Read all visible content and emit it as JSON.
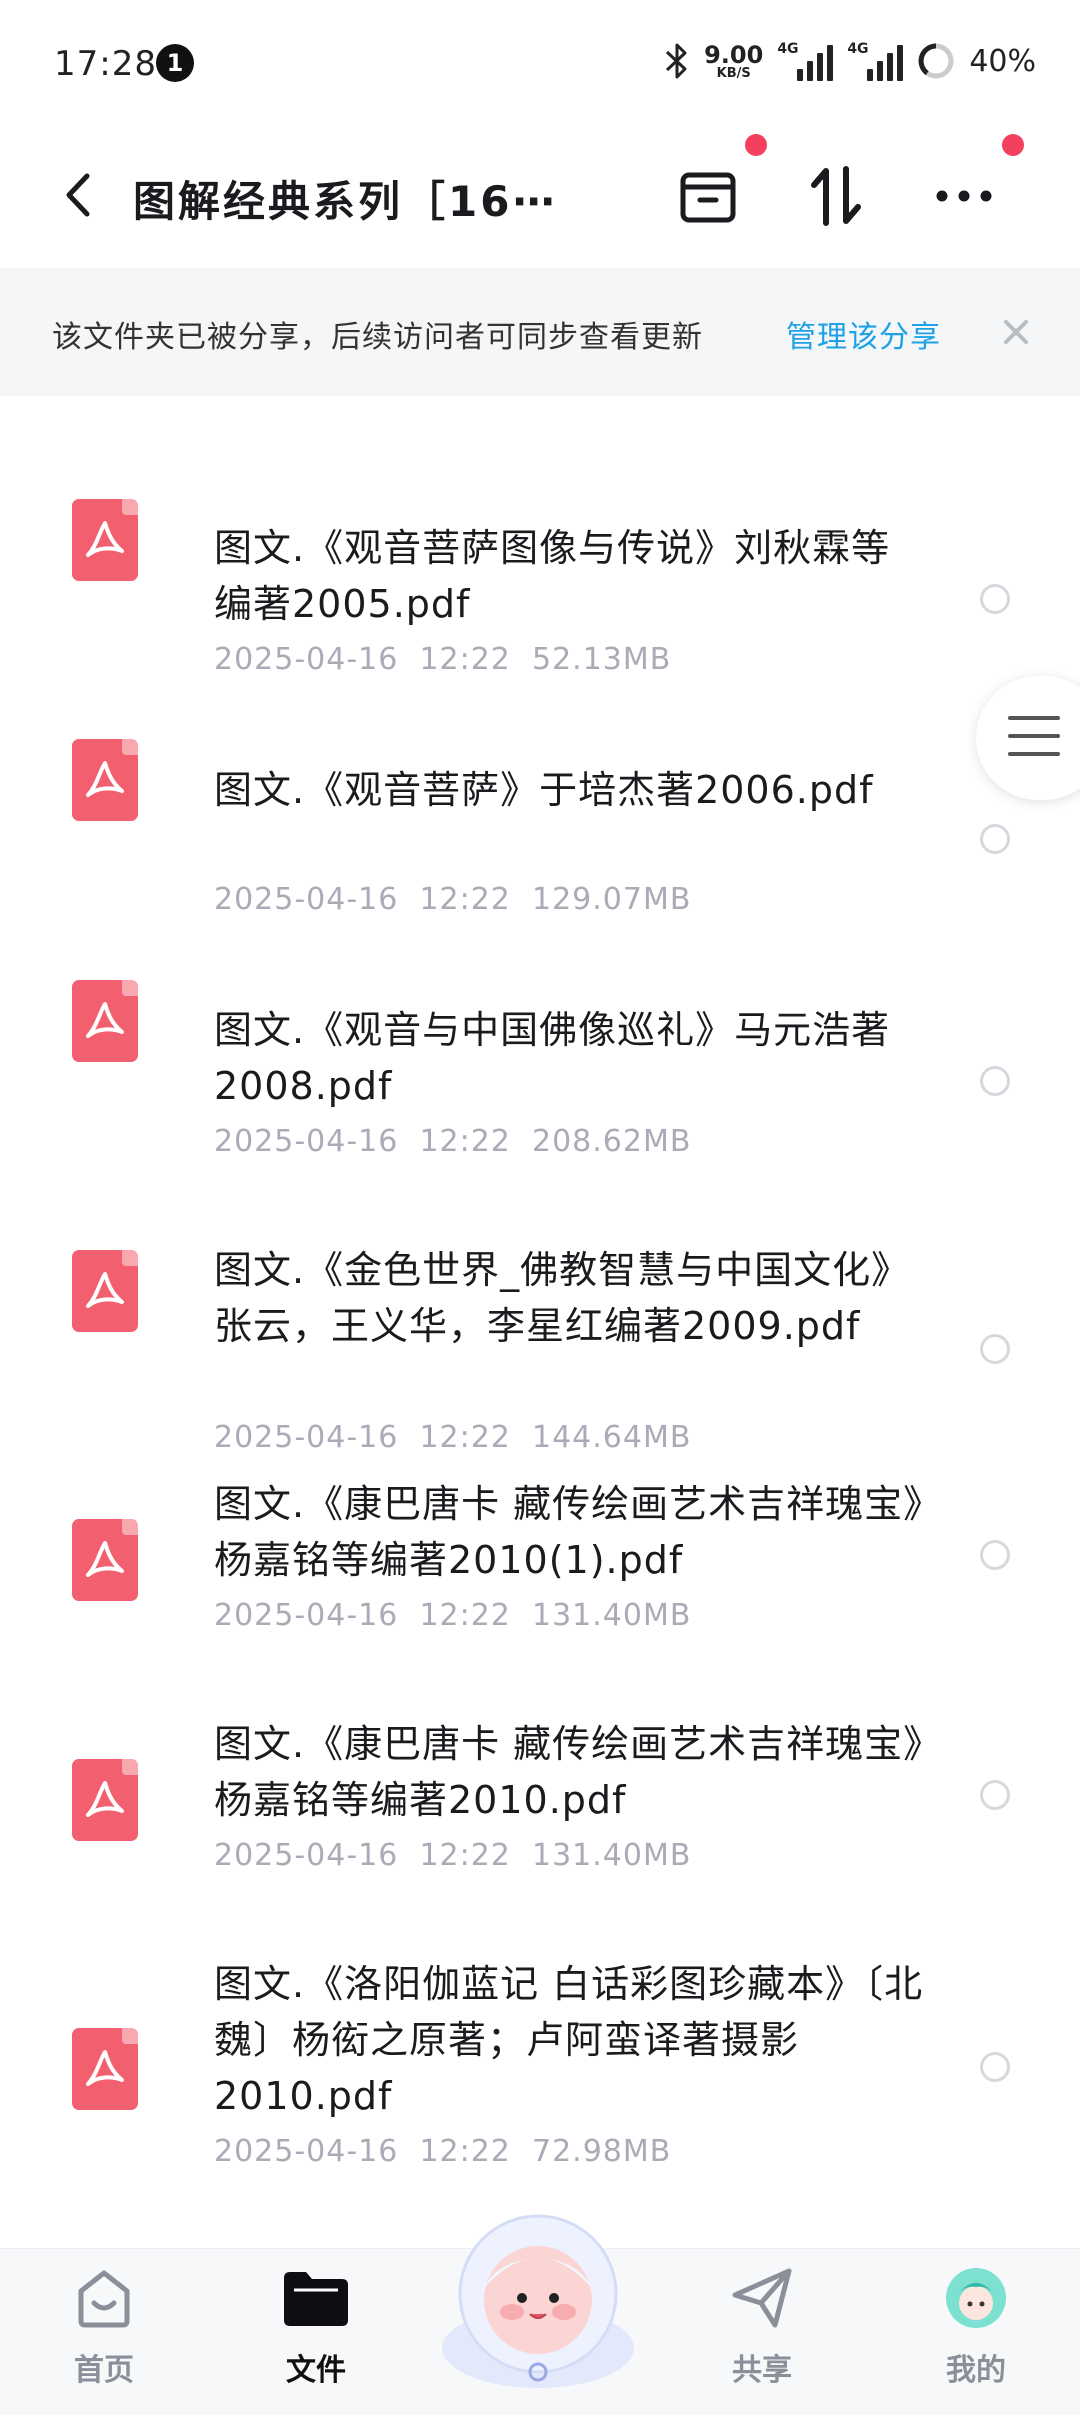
{
  "status_bar": {
    "time": "17:28",
    "notification_count": "1",
    "net_speed_value": "9.00",
    "net_speed_unit": "KB/S",
    "sim1_tag": "4G",
    "sim2_tag": "4G",
    "battery": "40%"
  },
  "header": {
    "title": "图解经典系列［16⋯",
    "icons": [
      "back-icon",
      "archive-icon",
      "sort-icon",
      "more-icon"
    ]
  },
  "share_banner": {
    "text": "该文件夹已被分享，后续访问者可同步查看更新",
    "link": "管理该分享"
  },
  "files": [
    {
      "name": "图文.《观音菩萨图像与传说》刘秋霖等编著2005.pdf",
      "date": "2025-04-16",
      "time": "12:22",
      "size": "52.13MB"
    },
    {
      "name": "图文.《观音菩萨》于培杰著2006.pdf",
      "date": "2025-04-16",
      "time": "12:22",
      "size": "129.07MB"
    },
    {
      "name": "图文.《观音与中国佛像巡礼》马元浩著2008.pdf",
      "date": "2025-04-16",
      "time": "12:22",
      "size": "208.62MB"
    },
    {
      "name": "图文.《金色世界_佛教智慧与中国文化》张云，王义华，李星红编著2009.pdf",
      "date": "2025-04-16",
      "time": "12:22",
      "size": "144.64MB"
    },
    {
      "name": "图文.《康巴唐卡 藏传绘画艺术吉祥瑰宝》杨嘉铭等编著2010(1).pdf",
      "date": "2025-04-16",
      "time": "12:22",
      "size": "131.40MB"
    },
    {
      "name": "图文.《康巴唐卡 藏传绘画艺术吉祥瑰宝》杨嘉铭等编著2010.pdf",
      "date": "2025-04-16",
      "time": "12:22",
      "size": "131.40MB"
    },
    {
      "name": "图文.《洛阳伽蓝记 白话彩图珍藏本》〔北魏〕杨衒之原著；卢阿蛮译著摄影2010.pdf",
      "date": "2025-04-16",
      "time": "12:22",
      "size": "72.98MB"
    }
  ],
  "bottom_nav": [
    {
      "label": "首页",
      "icon": "home-icon"
    },
    {
      "label": "文件",
      "icon": "folder-icon"
    },
    {
      "label": "共享",
      "icon": "share-icon"
    },
    {
      "label": "我的",
      "icon": "avatar-icon"
    }
  ],
  "colors": {
    "accent": "#1ea2e5",
    "pdf": "#f2606f",
    "badge": "#f2405e"
  }
}
